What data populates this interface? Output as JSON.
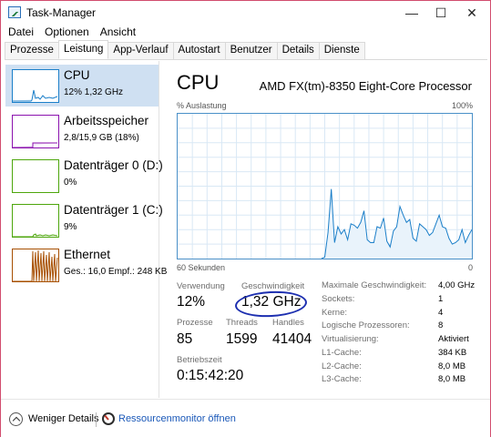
{
  "window": {
    "title": "Task-Manager",
    "controls": {
      "minimize": "—",
      "maximize": "☐",
      "close": "✕"
    }
  },
  "menu": [
    "Datei",
    "Optionen",
    "Ansicht"
  ],
  "tabs": [
    "Prozesse",
    "Leistung",
    "App-Verlauf",
    "Autostart",
    "Benutzer",
    "Details",
    "Dienste"
  ],
  "active_tab": "Leistung",
  "sidebar": {
    "items": [
      {
        "name": "CPU",
        "sub": "12% 1,32 GHz",
        "color": "#1b7fc9",
        "selected": true
      },
      {
        "name": "Arbeitsspeicher",
        "sub": "2,8/15,9 GB (18%)",
        "color": "#8b12ae",
        "selected": false
      },
      {
        "name": "Datenträger 0 (D:)",
        "sub": "0%",
        "color": "#4da60c",
        "selected": false
      },
      {
        "name": "Datenträger 1 (C:)",
        "sub": "9%",
        "color": "#4da60c",
        "selected": false
      },
      {
        "name": "Ethernet",
        "sub": "Ges.: 16,0  Empf.: 248 KB",
        "color": "#a74f01",
        "selected": false
      }
    ]
  },
  "main": {
    "title": "CPU",
    "model": "AMD FX(tm)-8350 Eight-Core Processor",
    "axis": {
      "top_left": "% Auslastung",
      "top_right": "100%",
      "bottom_left": "60 Sekunden",
      "bottom_right": "0"
    },
    "stats": {
      "usage_label": "Verwendung",
      "usage_value": "12%",
      "speed_label": "Geschwindigkeit",
      "speed_value": "1,32 GHz",
      "processes_label": "Prozesse",
      "processes_value": "85",
      "threads_label": "Threads",
      "threads_value": "1599",
      "handles_label": "Handles",
      "handles_value": "41404",
      "uptime_label": "Betriebszeit",
      "uptime_value": "0:15:42:20"
    },
    "specs": [
      {
        "label": "Maximale Geschwindigkeit:",
        "value": "4,00 GHz"
      },
      {
        "label": "Sockets:",
        "value": "1"
      },
      {
        "label": "Kerne:",
        "value": "4"
      },
      {
        "label": "Logische Prozessoren:",
        "value": "8"
      },
      {
        "label": "Virtualisierung:",
        "value": "Aktiviert"
      },
      {
        "label": "L1-Cache:",
        "value": "384 KB"
      },
      {
        "label": "L2-Cache:",
        "value": "8,0 MB"
      },
      {
        "label": "L3-Cache:",
        "value": "8,0 MB"
      }
    ],
    "graph_series_pct": [
      0,
      0,
      0,
      0,
      0,
      0,
      0,
      0,
      0,
      0,
      0,
      0,
      0,
      0,
      0,
      0,
      0,
      0,
      0,
      0,
      0,
      0,
      0,
      0,
      0,
      0,
      0,
      0,
      0,
      0,
      0,
      0,
      0,
      0,
      0,
      0,
      0,
      0,
      0,
      0,
      0,
      0,
      0,
      0,
      0,
      1,
      18,
      48,
      11,
      22,
      17,
      20,
      13,
      24,
      23,
      21,
      25,
      33,
      13,
      11,
      11,
      22,
      21,
      28,
      12,
      8,
      19,
      22,
      36,
      30,
      25,
      27,
      14,
      12,
      24,
      22,
      20,
      16,
      18,
      24,
      30,
      22,
      21,
      14,
      10,
      11,
      13,
      20,
      11,
      16,
      20
    ]
  },
  "footer": {
    "less_details": "Weniger Details",
    "resource_monitor": "Ressourcenmonitor öffnen"
  },
  "colors": {
    "graph_line": "#1b7fc9",
    "graph_fill": "#e9f3fb",
    "grid": "#d9e8f5",
    "annotation_circle": "#1d2fb0"
  }
}
